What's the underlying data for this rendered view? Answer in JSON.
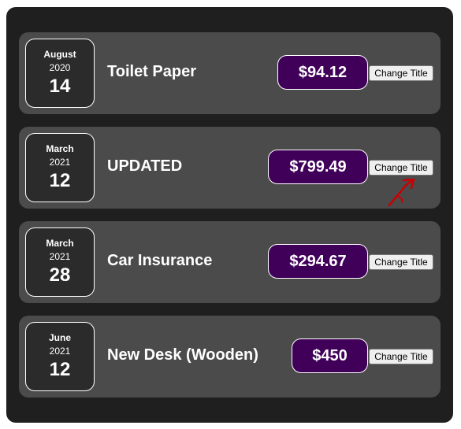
{
  "expenses": [
    {
      "month": "August",
      "year": "2020",
      "day": "14",
      "title": "Toilet Paper",
      "amount": "$94.12",
      "button_label": "Change Title"
    },
    {
      "month": "March",
      "year": "2021",
      "day": "12",
      "title": "UPDATED",
      "amount": "$799.49",
      "button_label": "Change Title"
    },
    {
      "month": "March",
      "year": "2021",
      "day": "28",
      "title": "Car Insurance",
      "amount": "$294.67",
      "button_label": "Change Title"
    },
    {
      "month": "June",
      "year": "2021",
      "day": "12",
      "title": "New Desk (Wooden)",
      "amount": "$450",
      "button_label": "Change Title"
    }
  ],
  "colors": {
    "panel_background": "#1f1f1f",
    "item_background": "#4b4b4b",
    "date_background": "#2b2b2b",
    "price_background": "#40005a",
    "annotation": "#cc0000"
  },
  "annotation_icon": "hand-drawn-arrow-icon"
}
